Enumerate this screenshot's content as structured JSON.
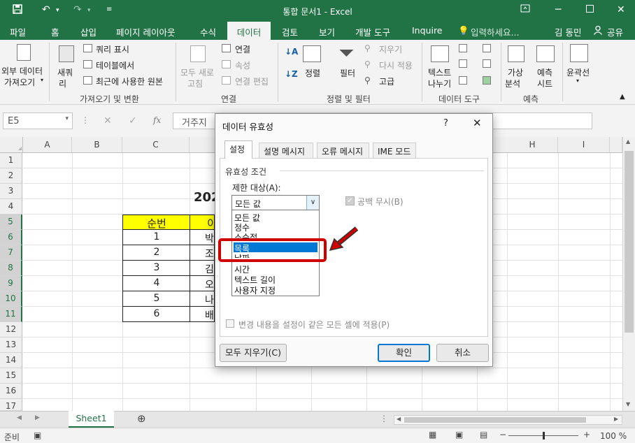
{
  "window": {
    "title": "통합 문서1 - Excel",
    "user": "김 동민",
    "share": "공유",
    "tell_me": "입력하세요..."
  },
  "ribbon_tabs": [
    "파일",
    "홈",
    "삽입",
    "페이지 레이아웃",
    "수식",
    "데이터",
    "검토",
    "보기",
    "개발 도구",
    "Inquire"
  ],
  "ribbon": {
    "get_external": [
      "외부 데이터",
      "가져오기"
    ],
    "new_query": [
      "새쿼",
      "리"
    ],
    "query_show": "쿼리 표시",
    "from_table": "테이블에서",
    "recent_sources": "최근에 사용한 원본",
    "group_get": "가져오기 및 변환",
    "refresh_all": [
      "모두 새로",
      "고침"
    ],
    "connections": "연결",
    "properties": "속성",
    "edit_links": "연결 편집",
    "group_conn": "연결",
    "sort": "정렬",
    "filter": "필터",
    "clear": "지우기",
    "reapply": "다시 적용",
    "advanced": "고급",
    "group_sort": "정렬 및 필터",
    "text_to_columns": [
      "텍스트",
      "나누기"
    ],
    "group_tools": "데이터 도구",
    "what_if": [
      "가상",
      "분석"
    ],
    "forecast_sheet": [
      "예측",
      "시트"
    ],
    "group_forecast": "예측",
    "outline": "윤곽선"
  },
  "formula_bar": {
    "name_box": "E5",
    "formula_preview": "거주지"
  },
  "columns": [
    "A",
    "B",
    "C",
    "D",
    "E",
    "F",
    "G",
    "H",
    "I"
  ],
  "rows": [
    "1",
    "2",
    "3",
    "4",
    "5",
    "6",
    "7",
    "8",
    "9",
    "10",
    "11",
    "12",
    "13",
    "14",
    "15",
    "16",
    "17"
  ],
  "sheet": {
    "title_fragment": "202",
    "header": "순번",
    "header_d_fragment": "이",
    "numbers": [
      "1",
      "2",
      "3",
      "4",
      "5",
      "6"
    ],
    "d_fragments": [
      "박",
      "조",
      "김",
      "오",
      "나",
      "배"
    ]
  },
  "sheet_tabs": [
    "Sheet1"
  ],
  "status": {
    "ready": "준비",
    "zoom": "100 %"
  },
  "dialog": {
    "title": "데이터 유효성",
    "help": "?",
    "close": "✕",
    "tabs": [
      "설정",
      "설명 메시지",
      "오류 메시지",
      "IME 모드"
    ],
    "section": "유효성 조건",
    "allow_label": "제한 대상(A):",
    "allow_value": "모든 값",
    "ignore_blank": "공백 무시(B)",
    "list_items": [
      "모든 값",
      "정수",
      "소수점",
      "목록",
      "날짜",
      "시간",
      "텍스트 길이",
      "사용자 지정"
    ],
    "selected_item": "목록",
    "apply_all": "변경 내용을 설정이 같은 모든 셀에 적용(P)",
    "clear_all": "모두 지우기(C)",
    "ok": "확인",
    "cancel": "취소"
  },
  "colors": {
    "excel_green": "#217346",
    "header_yellow": "#ffff00",
    "selection_blue": "#0078d4",
    "highlight_red": "#d00000"
  }
}
